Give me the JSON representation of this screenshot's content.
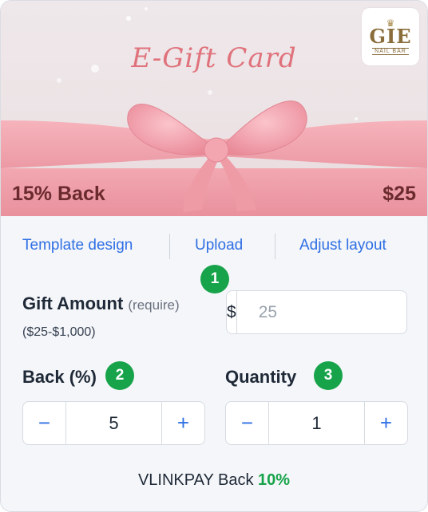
{
  "card": {
    "title": "E-Gift Card",
    "back_label": "15% Back",
    "price_label": "$25",
    "logo": {
      "mark": "GIE",
      "sub": "NAIL BAR",
      "crown": "♛"
    }
  },
  "tabs": [
    {
      "label": "Template design"
    },
    {
      "label": "Upload"
    },
    {
      "label": "Adjust layout"
    }
  ],
  "badges": [
    "1",
    "2",
    "3"
  ],
  "gift_amount": {
    "label": "Gift Amount",
    "required_hint": "(require)",
    "range": "($25-$1,000)",
    "currency": "$",
    "placeholder": "25",
    "value": ""
  },
  "back_percent": {
    "label": "Back (%)",
    "minus": "−",
    "value": "5",
    "plus": "+"
  },
  "quantity": {
    "label": "Quantity",
    "minus": "−",
    "value": "1",
    "plus": "+"
  },
  "footer": {
    "text": "VLINKPAY Back",
    "percent": "10%"
  },
  "colors": {
    "accent_blue": "#2f6fe4",
    "badge_green": "#17a34a",
    "ribbon_pink": "#f2a3ac",
    "title_pink": "#e0727c"
  }
}
